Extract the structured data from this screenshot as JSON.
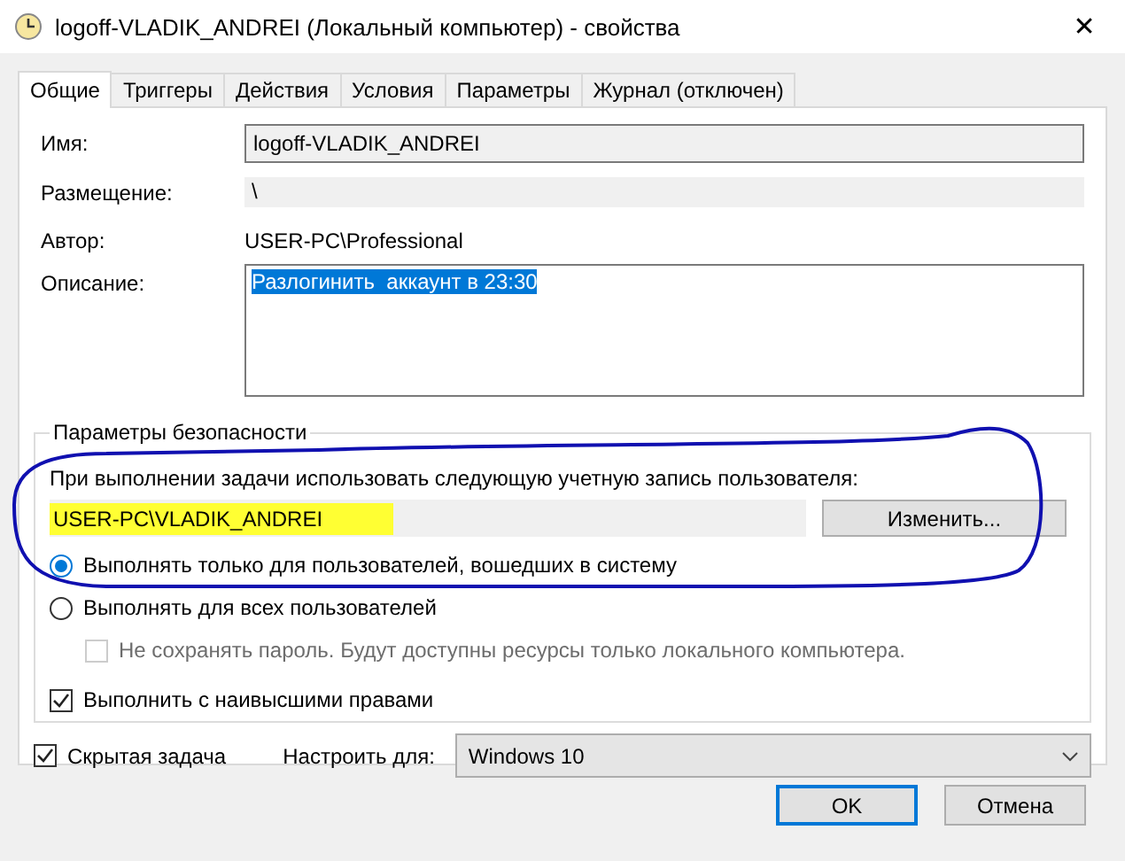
{
  "window": {
    "title": "logoff-VLADIK_ANDREI (Локальный компьютер) - свойства",
    "close": "✕"
  },
  "tabs": [
    {
      "label": "Общие",
      "selected": true
    },
    {
      "label": "Триггеры",
      "selected": false
    },
    {
      "label": "Действия",
      "selected": false
    },
    {
      "label": "Условия",
      "selected": false
    },
    {
      "label": "Параметры",
      "selected": false
    },
    {
      "label": "Журнал (отключен)",
      "selected": false
    }
  ],
  "general": {
    "name_label": "Имя:",
    "name": "logoff-VLADIK_ANDREI",
    "location_label": "Размещение:",
    "location": "\\",
    "author_label": "Автор:",
    "author": "USER-PC\\Professional",
    "description_label": "Описание:",
    "description": "Разлогинить  аккаунт в 23:30",
    "description_selected": true
  },
  "security": {
    "title": "Параметры безопасности",
    "prompt": "При выполнении задачи использовать следующую учетную запись пользователя:",
    "account": "USER-PC\\VLADIK_ANDREI",
    "account_highlighted": true,
    "change_button": "Изменить...",
    "run_options": [
      {
        "label": "Выполнять только для пользователей, вошедших в систему",
        "selected": true
      },
      {
        "label": "Выполнять для всех пользователей",
        "selected": false
      }
    ],
    "no_store_password": {
      "label": "Не сохранять пароль. Будут доступны ресурсы только локального компьютера.",
      "checked": false,
      "disabled": true
    },
    "highest_privileges": {
      "label": "Выполнить с наивысшими правами",
      "checked": true,
      "disabled": false
    }
  },
  "hidden_task": {
    "label": "Скрытая задача",
    "checked": true
  },
  "configure_for": {
    "label": "Настроить для:",
    "value": "Windows 10"
  },
  "buttons": [
    {
      "label": "OK",
      "default": true
    },
    {
      "label": "Отмена",
      "default": false
    }
  ]
}
